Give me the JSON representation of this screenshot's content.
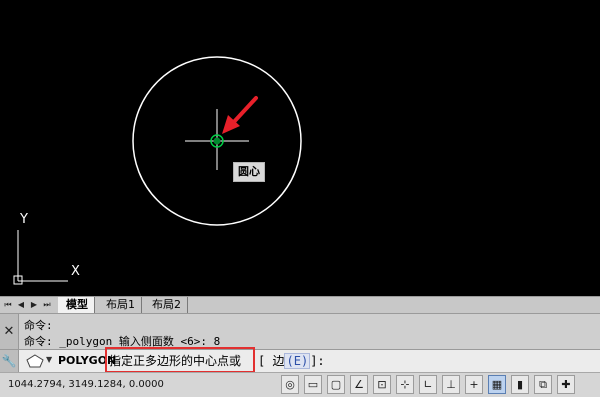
{
  "canvas": {
    "tooltip": "圆心",
    "ucs_x_label": "X",
    "ucs_y_label": "Y",
    "circle_color": "#ffffff",
    "center_marker_color": "#00cc44",
    "arrow_color": "#e8202a"
  },
  "tabs": {
    "nav_first": "⏮",
    "nav_prev": "◀",
    "nav_next": "▶",
    "nav_last": "⏭",
    "items": [
      {
        "label": "模型",
        "active": true
      },
      {
        "label": "布局1",
        "active": false
      },
      {
        "label": "布局2",
        "active": false
      }
    ]
  },
  "command_history": {
    "line1": "命令:",
    "line2": "命令: _polygon 输入侧面数 <6>: 8"
  },
  "command_input": {
    "command_name": "POLYGON",
    "prompt": "指定正多边形的中心点或",
    "option_open": "[",
    "option_label": "边",
    "option_paren_open": "(",
    "option_key": "E",
    "option_paren_close": ")",
    "option_close": "]:",
    "highlight_color": "#e23030"
  },
  "status_bar": {
    "coordinates": "1044.2794, 3149.1284, 0.0000",
    "icons": [
      {
        "name": "snap-mode-icon",
        "glyph": "◎",
        "on": false
      },
      {
        "name": "grid-mode-icon",
        "glyph": "▭",
        "on": false
      },
      {
        "name": "ortho-mode-icon",
        "glyph": "▢",
        "on": false
      },
      {
        "name": "polar-tracking-icon",
        "glyph": "∠",
        "on": false
      },
      {
        "name": "object-snap-icon",
        "glyph": "⊡",
        "on": false
      },
      {
        "name": "3d-object-snap-icon",
        "glyph": "⊹",
        "on": false
      },
      {
        "name": "object-snap-tracking-icon",
        "glyph": "∟",
        "on": false
      },
      {
        "name": "allow-ucs-icon",
        "glyph": "⊥",
        "on": false
      },
      {
        "name": "dynamic-input-icon",
        "glyph": "+",
        "on": false
      },
      {
        "name": "lineweight-icon",
        "glyph": "▦",
        "on": true
      },
      {
        "name": "transparency-icon",
        "glyph": "▮",
        "on": false
      },
      {
        "name": "quick-properties-icon",
        "glyph": "⧉",
        "on": false
      },
      {
        "name": "selection-cycling-icon",
        "glyph": "✚",
        "on": false
      }
    ]
  }
}
